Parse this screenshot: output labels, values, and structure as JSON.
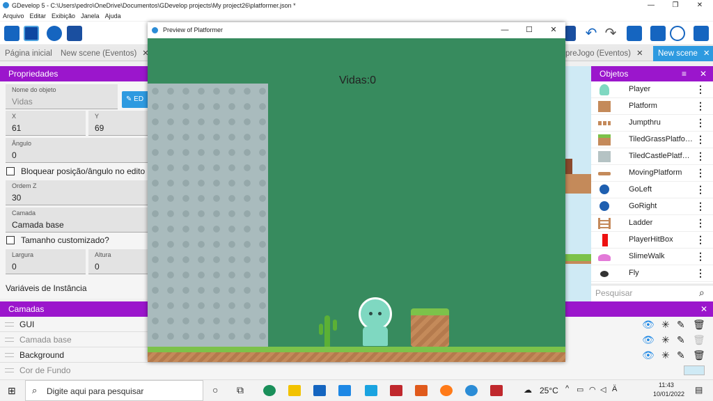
{
  "window": {
    "title": "GDevelop 5 - C:\\Users\\pedro\\OneDrive\\Documentos\\GDevelop projects\\My project26\\platformer.json *"
  },
  "menu": [
    "Arquivo",
    "Editar",
    "Exibição",
    "Janela",
    "Ajuda"
  ],
  "tabs": [
    {
      "label": "Página inicial",
      "active": false
    },
    {
      "label": "New scene (Eventos)",
      "active": false
    },
    {
      "label": "preJogo (Eventos)",
      "active": false
    },
    {
      "label": "New scene",
      "active": true
    }
  ],
  "properties": {
    "header": "Propriedades",
    "object_name_label": "Nome do objeto",
    "object_name_value": "Vidas",
    "edit_button": "ED",
    "x_label": "X",
    "x_value": "61",
    "y_label": "Y",
    "y_value": "69",
    "angle_label": "Ângulo",
    "angle_value": "0",
    "lock_label": "Bloquear posição/ângulo no edito",
    "z_label": "Ordem Z",
    "z_value": "30",
    "layer_label": "Camada",
    "layer_value": "Camada base",
    "custom_size_label": "Tamanho customizado?",
    "width_label": "Largura",
    "width_value": "0",
    "height_label": "Altura",
    "height_value": "0",
    "instance_vars": "Variáveis de Instância"
  },
  "layers": {
    "header": "Camadas",
    "items": [
      {
        "name": "GUI",
        "dim": false
      },
      {
        "name": "Camada base",
        "dim": true
      },
      {
        "name": "Background",
        "dim": false
      },
      {
        "name": "Cor de Fundo",
        "dim": true
      }
    ]
  },
  "objects": {
    "header": "Objetos",
    "items": [
      {
        "name": "Player",
        "color": "#7fd8c1"
      },
      {
        "name": "Platform",
        "color": "#c48a5a"
      },
      {
        "name": "Jumpthru",
        "color": "#c4895a"
      },
      {
        "name": "TiledGrassPlatfo…",
        "color": "#7cc24a"
      },
      {
        "name": "TiledCastlePlatf…",
        "color": "#b5c3c4"
      },
      {
        "name": "MovingPlatform",
        "color": "#c48a5a"
      },
      {
        "name": "GoLeft",
        "color": "#1e5fb0"
      },
      {
        "name": "GoRight",
        "color": "#1e5fb0"
      },
      {
        "name": "Ladder",
        "color": "#c4895a"
      },
      {
        "name": "PlayerHitBox",
        "color": "#ee1111"
      },
      {
        "name": "SlimeWalk",
        "color": "#e37ad8"
      },
      {
        "name": "Fly",
        "color": "#333333"
      }
    ],
    "search_placeholder": "Pesquisar"
  },
  "preview": {
    "title": "Preview of Platformer",
    "lives_text": "Vidas:0"
  },
  "taskbar": {
    "search_placeholder": "Digite aqui para pesquisar",
    "weather": "25°C",
    "time": "11:43",
    "date": "10/01/2022"
  },
  "colors": {
    "accent": "#9b16cc",
    "tab_active": "#2e9ae0",
    "game_bg": "#378b5e"
  }
}
